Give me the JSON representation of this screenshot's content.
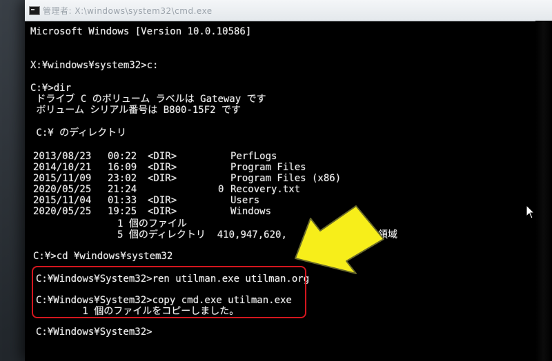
{
  "window": {
    "title": "管理者: X:\\windows\\system32\\cmd.exe"
  },
  "console": {
    "version_line": "Microsoft Windows [Version 10.0.10586]",
    "prompt1": "X:¥windows¥system32>c:",
    "prompt2": "C:¥>dir",
    "volume_label": " ドライブ C のボリューム ラベルは Gateway です",
    "volume_serial": " ボリューム シリアル番号は B800-15F2 です",
    "directory_of": " C:¥ のディレクトリ",
    "entries": [
      {
        "date": "2013/08/23",
        "time": "00:22",
        "type": "<DIR>",
        "size": "",
        "name": "PerfLogs"
      },
      {
        "date": "2014/10/21",
        "time": "16:09",
        "type": "<DIR>",
        "size": "",
        "name": "Program Files"
      },
      {
        "date": "2015/11/09",
        "time": "23:02",
        "type": "<DIR>",
        "size": "",
        "name": "Program Files (x86)"
      },
      {
        "date": "2020/05/25",
        "time": "21:24",
        "type": "",
        "size": "0",
        "name": "Recovery.txt"
      },
      {
        "date": "2015/11/04",
        "time": "01:33",
        "type": "<DIR>",
        "size": "",
        "name": "Users"
      },
      {
        "date": "2020/05/25",
        "time": "19:25",
        "type": "<DIR>",
        "size": "",
        "name": "Windows"
      }
    ],
    "summary_files": "1 個のファイル",
    "summary_dirs": "5 個のディレクトリ  410,947,620,",
    "summary_free": "空き領域",
    "prompt3": "C:¥>cd ¥windows¥system32",
    "prompt4": "C:¥Windows¥System32>ren utilman.exe utilman.org",
    "prompt5": "C:¥Windows¥System32>copy cmd.exe utilman.exe",
    "copy_result": "        1 個のファイルをコピーしました。",
    "prompt6": "C:¥Windows¥System32>"
  },
  "colors": {
    "console_text": "#ececec",
    "console_bg": "#000000",
    "highlight_border": "#d4161e",
    "arrow_fill": "#f7ee1a",
    "arrow_outline": "#6a6a2a"
  },
  "icons": {
    "app_icon": "cmd-icon",
    "arrow": "pointer-arrow-icon",
    "cursor": "mouse-cursor-icon"
  }
}
